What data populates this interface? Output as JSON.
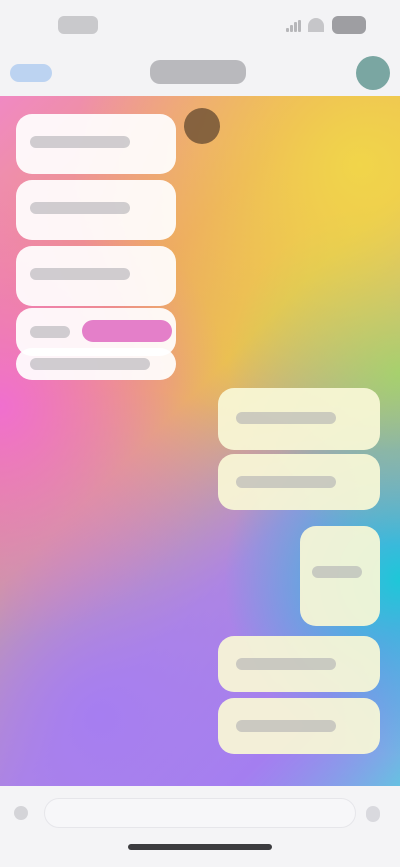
{
  "app": {
    "title": ""
  },
  "status": {
    "time": ""
  },
  "nav": {
    "back_label": "",
    "title": ""
  },
  "composer": {
    "placeholder": ""
  },
  "colors": {
    "gradient_pink": "#f06fcf",
    "gradient_yellow": "#f1d54a",
    "gradient_green": "#8ccf7a",
    "gradient_cyan": "#1ec7d8",
    "gradient_purple": "#a67ef1",
    "incoming_bubble": "#ffffff",
    "outgoing_bubble": "#f9f7d6",
    "accent": "#007aff"
  },
  "messages": [
    {
      "side": "incoming",
      "text": ""
    },
    {
      "side": "incoming",
      "text": ""
    },
    {
      "side": "incoming",
      "text": ""
    },
    {
      "side": "incoming",
      "text": ""
    },
    {
      "side": "incoming",
      "text": ""
    },
    {
      "side": "outgoing",
      "text": ""
    },
    {
      "side": "outgoing",
      "text": ""
    },
    {
      "side": "outgoing",
      "text": ""
    },
    {
      "side": "outgoing",
      "text": ""
    },
    {
      "side": "outgoing",
      "text": ""
    }
  ],
  "icons": [
    "signal-icon",
    "wifi-icon",
    "battery-icon",
    "attach-icon",
    "mic-icon"
  ]
}
